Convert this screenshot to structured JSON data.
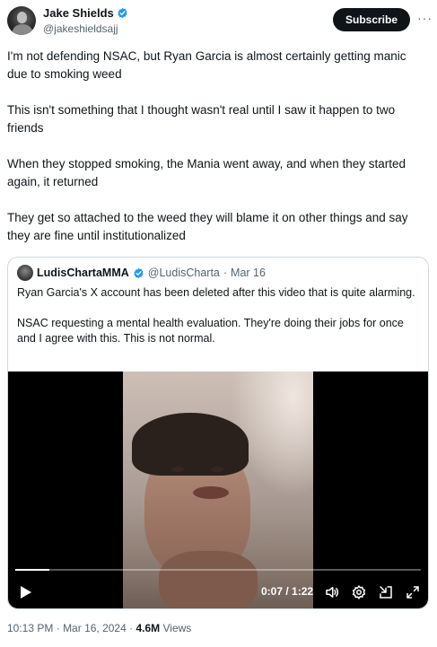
{
  "author": {
    "name": "Jake Shields",
    "handle": "@jakeshieldsajj"
  },
  "actions": {
    "subscribe_label": "Subscribe",
    "more_label": "···"
  },
  "tweet": {
    "paragraphs": [
      "I'm not defending NSAC, but Ryan Garcia is almost certainly getting manic due to smoking weed",
      "This isn't something that I thought wasn't real until I saw it happen to two friends",
      "When they stopped smoking, the Mania went away, and when they started again, it returned",
      "They get so attached to the weed they will blame it on other things and say they are fine until institutionalized"
    ]
  },
  "quote": {
    "name": "LudisChartaMMA",
    "handle": "@LudisCharta",
    "separator": "·",
    "date": "Mar 16",
    "paragraphs": [
      "Ryan Garcia's X account has been deleted after this video that is quite alarming.",
      "NSAC requesting a mental health evaluation. They're doing their jobs for once and I agree with this. This is not normal."
    ],
    "video": {
      "timecode": "0:07 / 1:22",
      "progress": 0.085
    }
  },
  "meta": {
    "time": "10:13 PM",
    "date": "Mar 16, 2024",
    "views_count": "4.6M",
    "views_label": "Views",
    "separator": "·"
  },
  "colors": {
    "verified": "#1d9bf0",
    "text": "#0f1419",
    "muted": "#536471",
    "border": "#cfd9de"
  },
  "icons": [
    "verified-badge-icon",
    "play-icon",
    "volume-icon",
    "settings-icon",
    "exit-embed-icon",
    "fullscreen-icon"
  ]
}
